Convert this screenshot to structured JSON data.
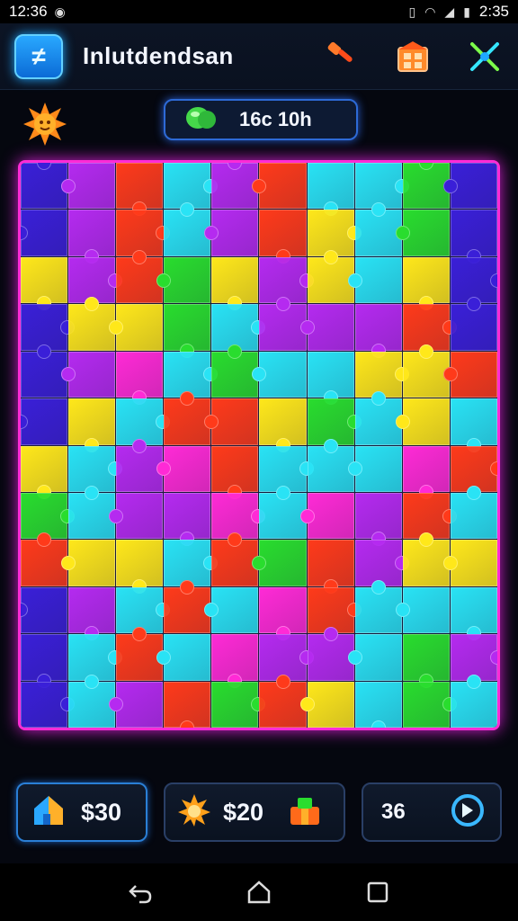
{
  "status_bar": {
    "left_time": "12:36",
    "right_time": "2:35",
    "icons": [
      "image-icon",
      "alarm-icon",
      "vibrate-icon",
      "wifi-icon",
      "signal-icon",
      "signal-icon",
      "battery-icon"
    ]
  },
  "header": {
    "menu_icon": "menu-logo-icon",
    "title": "Inlutdendsan",
    "icons": [
      "hammer-icon",
      "shop-icon",
      "settings-icon"
    ]
  },
  "info": {
    "left_icon": "sun-face-icon",
    "timer_icon": "gem-icon",
    "timer_text": "16c 10h"
  },
  "board": {
    "columns": 10,
    "rows": 12,
    "palette": {
      "B": "#3a1fd8",
      "P": "#b52af0",
      "R": "#ff3a1a",
      "C": "#29e3f5",
      "Y": "#ffe81a",
      "G": "#29dd2e",
      "M": "#ff2ad6",
      "O": "#ff5a1a"
    },
    "tiles": [
      "BPRCPRCCGB",
      "BPRCPRYCGB",
      "YPRGYPYCYB",
      "BYYGCPPPRB",
      "BPMCGCCYYR",
      "BYCRRYGCYC",
      "YCPMRCCCMR",
      "GCPPMCMPRC",
      "RYYCRGRPYY",
      "BPCRCMRCCC",
      "BCRCMPPCGP",
      "BCPRGRYCGC"
    ]
  },
  "bottom": {
    "item1": {
      "icon": "house-icon",
      "value": "$30"
    },
    "item2": {
      "icon": "gear-flower-icon",
      "value": "$20",
      "icon2": "gift-icon"
    },
    "item3": {
      "value": "36",
      "icon": "refresh-icon"
    }
  },
  "nav": [
    "back-icon",
    "home-icon",
    "recents-icon"
  ]
}
